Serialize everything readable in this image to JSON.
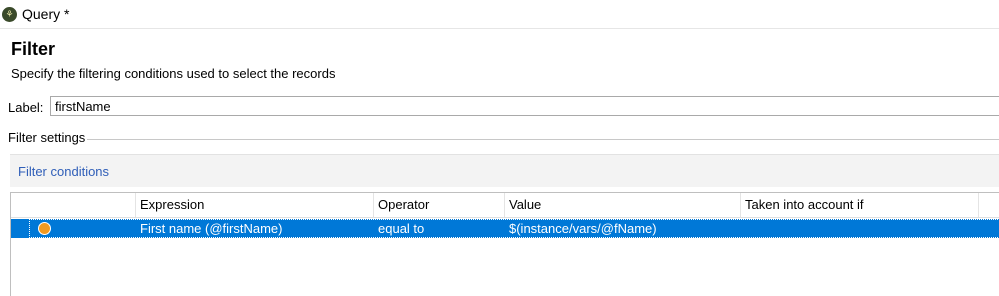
{
  "window": {
    "title": "Query *",
    "icon": "app-logo-icon"
  },
  "header": {
    "title": "Filter",
    "subtitle": "Specify the filtering conditions used to select the records"
  },
  "label_field": {
    "caption": "Label:",
    "value": "firstName"
  },
  "settings": {
    "caption": "Filter settings"
  },
  "conditions": {
    "link_label": "Filter conditions"
  },
  "grid": {
    "columns": [
      "",
      "Expression",
      "Operator",
      "Value",
      "Taken into account if",
      ""
    ],
    "rows": [
      {
        "status_color": "#f29a21",
        "expression": "First name (@firstName)",
        "operator": "equal to",
        "value": "$(instance/vars/@fName)",
        "taken_into_account_if": ""
      }
    ],
    "selection_color": "#0078d7"
  },
  "colors": {
    "link": "#2f5eb8",
    "selection": "#0078d7",
    "status_dot": "#f29a21"
  }
}
